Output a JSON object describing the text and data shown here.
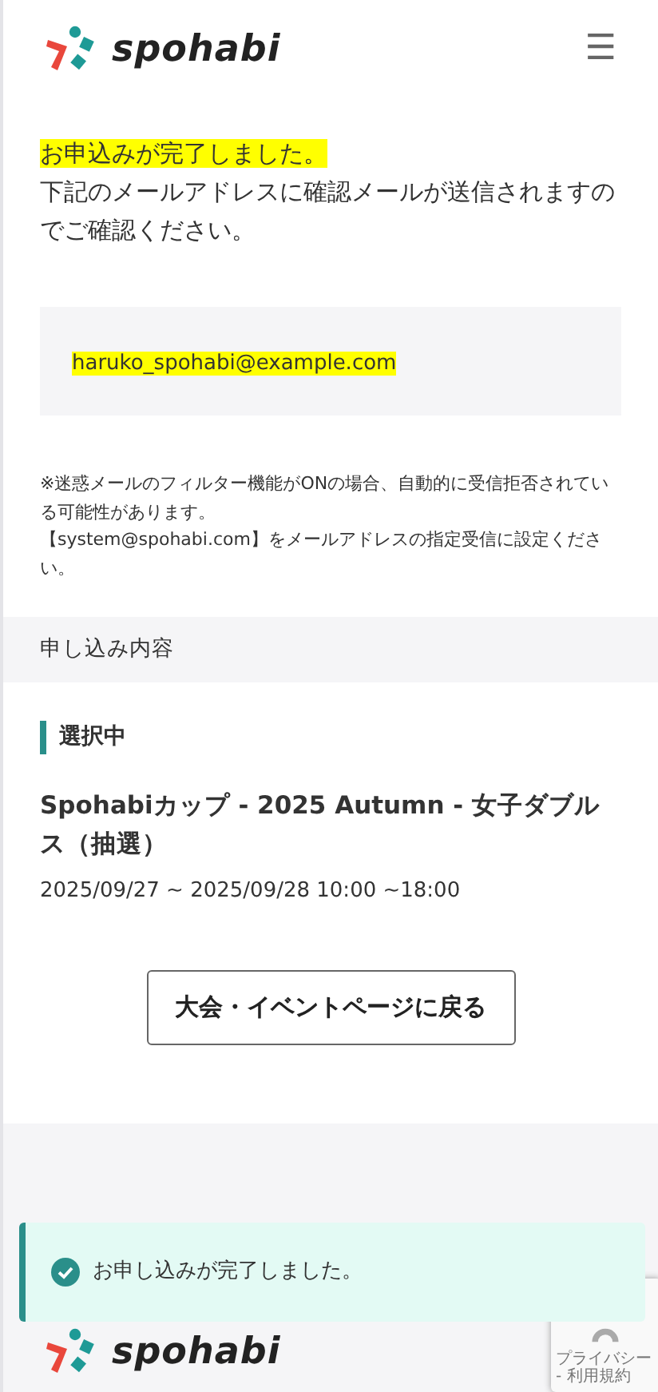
{
  "header": {
    "logo_text": "spohabi",
    "menu_icon": "☰"
  },
  "completion": {
    "headline": "お申込みが完了しました。",
    "message": "下記のメールアドレスに確認メールが送信されますのでご確認ください。"
  },
  "email": "haruko_spohabi@example.com",
  "notice": [
    "※迷惑メールのフィルター機能がONの場合、自動的に受信拒否されている可能性があります。",
    "【system@spohabi.com】をメールアドレスの指定受信に設定ください。"
  ],
  "section_title": "申し込み内容",
  "selection": {
    "label": "選択中",
    "event_title": "Spohabiカップ - 2025 Autumn - 女子ダブルス（抽選）",
    "dates": "2025/09/27 ~ 2025/09/28 10:00 ~18:00"
  },
  "back_button": "大会・イベントページに戻る",
  "footer": {
    "logo_text": "spohabi"
  },
  "toast": {
    "message": "お申し込みが完了しました。"
  },
  "recaptcha": {
    "links": "プライバシー - 利用規約"
  }
}
